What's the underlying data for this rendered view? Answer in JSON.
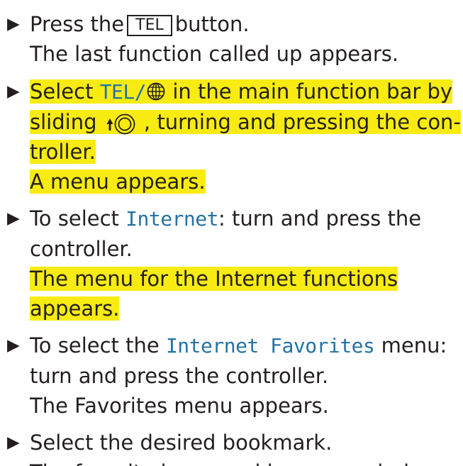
{
  "steps": [
    {
      "pre": "Press the",
      "button": "TEL",
      "post": "button.",
      "result": "The last function called up appears."
    },
    {
      "line1_pre": "Select ",
      "line1_code": "TEL/",
      "line1_post": " in the main function bar by",
      "line2_pre": "sliding",
      "line2_post": ", turning and pressing the con-",
      "line3": "troller.",
      "result": "A menu appears.",
      "icons": [
        "globe-icon",
        "slide-up-arrow-icon",
        "controller-dial-icon"
      ]
    },
    {
      "pre": "To select ",
      "code": "Internet",
      "post": ": turn and press the",
      "line2": "controller.",
      "result_line1": "The menu for the Internet functions",
      "result_line2": "appears."
    },
    {
      "pre": "To select the ",
      "code": "Internet Favorites",
      "post": " menu:",
      "line2": "turn and press the controller.",
      "result": "The Favorites menu appears."
    },
    {
      "text": "Select the desired bookmark.",
      "result": "The favorite is opened in a new window."
    }
  ],
  "colors": {
    "text": "#231f20",
    "highlight": "#f7eb12",
    "display_text": "#2472a4"
  }
}
